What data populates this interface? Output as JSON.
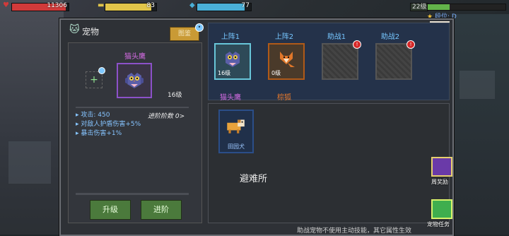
{
  "hud": {
    "hp": {
      "value": "11306",
      "fraction": 0.95,
      "color": "#d13a3a"
    },
    "energy": {
      "value": "83",
      "fraction": 0.9,
      "color": "#e2c54a"
    },
    "mana": {
      "value": "77",
      "fraction": 0.88,
      "color": "#4ab0d8"
    },
    "player_level": "22级",
    "rank_label": "段位: D",
    "xp_fraction": 0.28
  },
  "panel": {
    "title": "宠物",
    "illustration_button": "图鉴",
    "close_symbol": "✕"
  },
  "pet_detail": {
    "name": "猫头鹰",
    "level": "16级",
    "add_symbol": "+",
    "stats": [
      "攻击: 450",
      "对敌人护盾伤害+5%",
      "暴击伤害+1%"
    ],
    "advance_count": "进阶阶数 0>",
    "upgrade_button": "升级",
    "advance_button": "进阶"
  },
  "slots": [
    {
      "label": "上阵1",
      "state": "active",
      "pet_level": "16级",
      "pet_name": "猫头鹰",
      "name_color": "#d36be2"
    },
    {
      "label": "上阵2",
      "state": "filled",
      "pet_level": "0级",
      "pet_name": "棕狐",
      "name_color": "#e97a2a"
    },
    {
      "label": "助战1",
      "state": "empty",
      "alert": "!"
    },
    {
      "label": "助战2",
      "state": "empty",
      "alert": "!"
    }
  ],
  "collection": {
    "pets": [
      {
        "name": "田园犬"
      }
    ],
    "shelter_label": "避难所"
  },
  "side_buttons": {
    "weekly_reward": "周奖励",
    "pet_tasks": "宠物任务"
  },
  "bottom_tip": "助战宠物不使用主动技能，其它属性生效"
}
